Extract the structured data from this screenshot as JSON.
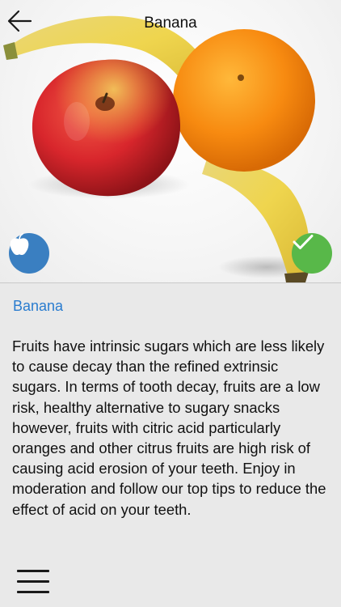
{
  "header": {
    "title": "Banana",
    "back_icon": "arrow-left-icon"
  },
  "hero": {
    "image": "fruits-photo",
    "left_badge_icon": "apple-icon",
    "right_badge_icon": "checkmark-icon",
    "left_badge_color": "#3a7fc1",
    "right_badge_color": "#58b849"
  },
  "content": {
    "fruit_name": "Banana",
    "fruit_name_color": "#2a7ccf",
    "description": "Fruits have intrinsic sugars which are less likely to cause decay than the refined extrinsic sugars. In terms of tooth decay, fruits are a low risk, healthy alternative to sugary snacks however, fruits with citric acid particularly oranges and other citrus fruits are high risk of causing acid erosion of your teeth. Enjoy in moderation and follow our top tips to reduce the effect of acid on your teeth."
  },
  "footer": {
    "menu_icon": "hamburger-menu-icon"
  }
}
